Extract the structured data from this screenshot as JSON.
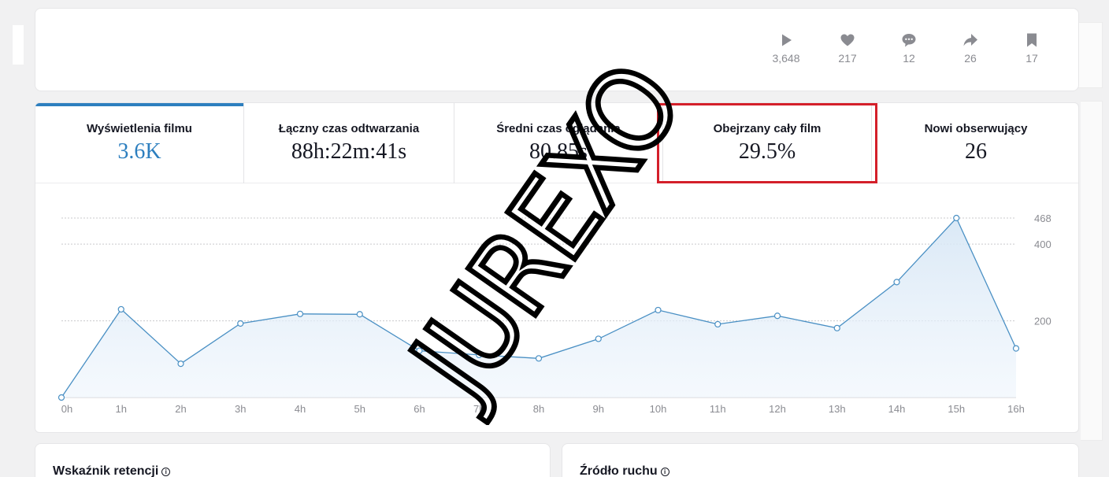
{
  "stats": [
    {
      "icon": "play-icon",
      "value": "3,648"
    },
    {
      "icon": "heart-icon",
      "value": "217"
    },
    {
      "icon": "comment-icon",
      "value": "12"
    },
    {
      "icon": "share-icon",
      "value": "26"
    },
    {
      "icon": "bookmark-icon",
      "value": "17"
    }
  ],
  "tabs": [
    {
      "label": "Wyświetlenia filmu",
      "value": "3.6K"
    },
    {
      "label": "Łączny czas odtwarzania",
      "value": "88h:22m:41s"
    },
    {
      "label": "Średni czas oglądania",
      "value": "80.85s"
    },
    {
      "label": "Obejrzany cały film",
      "value": "29.5%"
    },
    {
      "label": "Nowi obserwujący",
      "value": "26"
    }
  ],
  "chart_data": {
    "type": "area",
    "categories": [
      "0h",
      "1h",
      "2h",
      "3h",
      "4h",
      "5h",
      "6h",
      "7h",
      "8h",
      "9h",
      "10h",
      "11h",
      "12h",
      "13h",
      "14h",
      "15h",
      "16h"
    ],
    "values": [
      0,
      230,
      88,
      193,
      218,
      217,
      122,
      111,
      102,
      153,
      228,
      191,
      213,
      181,
      301,
      468,
      128
    ],
    "yticks": [
      "200",
      "400",
      "468"
    ],
    "ytick_values": [
      200,
      400,
      468
    ],
    "ylim": [
      0,
      468
    ],
    "grid": true,
    "colors": {
      "line": "#4a90c4",
      "fill": "#dbe9f6",
      "point_fill": "#ffffff"
    }
  },
  "sections": {
    "retention_title": "Wskaźnik retencji",
    "traffic_title": "Źródło ruchu"
  },
  "watermark": "JUREXO"
}
